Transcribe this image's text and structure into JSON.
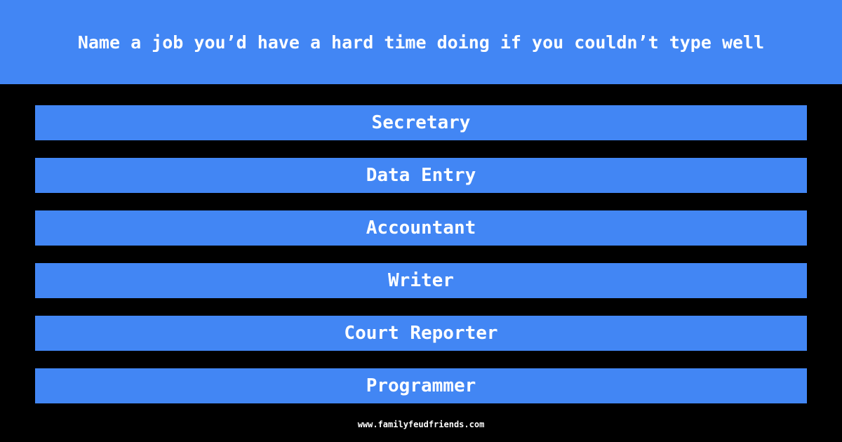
{
  "question": "Name a job you’d have a hard time doing if you couldn’t type well",
  "answers": [
    "Secretary",
    "Data Entry",
    "Accountant",
    "Writer",
    "Court Reporter",
    "Programmer"
  ],
  "footer": "www.familyfeudfriends.com",
  "colors": {
    "accent": "#4286f4",
    "background": "#000000"
  }
}
